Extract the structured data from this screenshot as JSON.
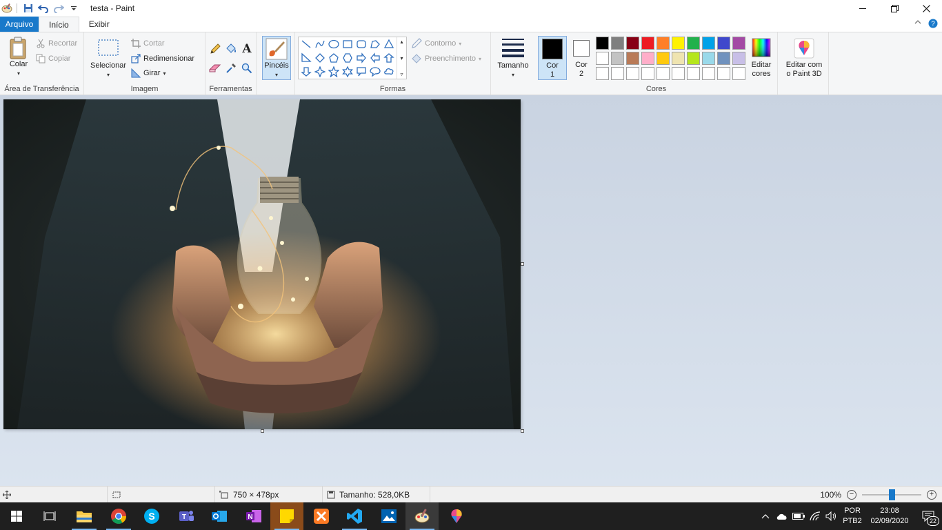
{
  "window": {
    "title": "testa - Paint",
    "controls": {
      "minimize": "—",
      "restore": "❐",
      "close": "✕"
    }
  },
  "tabs": {
    "file": "Arquivo",
    "home": "Início",
    "view": "Exibir"
  },
  "groups": {
    "clipboard": {
      "label": "Área de Transferência",
      "paste": "Colar",
      "cut": "Recortar",
      "copy": "Copiar"
    },
    "image": {
      "label": "Imagem",
      "select": "Selecionar",
      "crop": "Cortar",
      "resize": "Redimensionar",
      "rotate": "Girar"
    },
    "tools": {
      "label": "Ferramentas",
      "text_glyph": "A"
    },
    "brushes": {
      "label": "Pincéis"
    },
    "shapes": {
      "label": "Formas",
      "outline": "Contorno",
      "fill": "Preenchimento"
    },
    "size": {
      "label": "Tamanho"
    },
    "colors": {
      "label": "Cores",
      "color1_line1": "Cor",
      "color1_line2": "1",
      "color2_line1": "Cor",
      "color2_line2": "2",
      "edit_colors_line1": "Editar",
      "edit_colors_line2": "cores",
      "color1_value": "#000000",
      "color2_value": "#ffffff",
      "palette_row1": [
        "#000000",
        "#7f7f7f",
        "#880015",
        "#ed1c24",
        "#ff7f27",
        "#fff200",
        "#22b14c",
        "#00a2e8",
        "#3f48cc",
        "#a349a4"
      ],
      "palette_row2": [
        "#ffffff",
        "#c3c3c3",
        "#b97a57",
        "#ffaec9",
        "#ffc90e",
        "#efe4b0",
        "#b5e61d",
        "#99d9ea",
        "#7092be",
        "#c8bfe7"
      ],
      "palette_row3": [
        "#ffffff",
        "#ffffff",
        "#ffffff",
        "#ffffff",
        "#ffffff",
        "#ffffff",
        "#ffffff",
        "#ffffff",
        "#ffffff",
        "#ffffff"
      ]
    },
    "paint3d": {
      "line1": "Editar com",
      "line2": "o Paint 3D"
    }
  },
  "status": {
    "dimensions": "750 × 478px",
    "file_size": "Tamanho: 528,0KB",
    "zoom": "100%",
    "zoom_minus": "−",
    "zoom_plus": "+"
  },
  "taskbar": {
    "apps": [
      "start",
      "task-view",
      "file-explorer",
      "chrome",
      "skype",
      "teams",
      "outlook",
      "onenote",
      "sticky-notes",
      "xampp",
      "vscode",
      "photos",
      "paint",
      "paint-3d"
    ],
    "language_line1": "POR",
    "language_line2": "PTB2",
    "time": "23:08",
    "date": "02/09/2020",
    "notifications_count": "22"
  }
}
